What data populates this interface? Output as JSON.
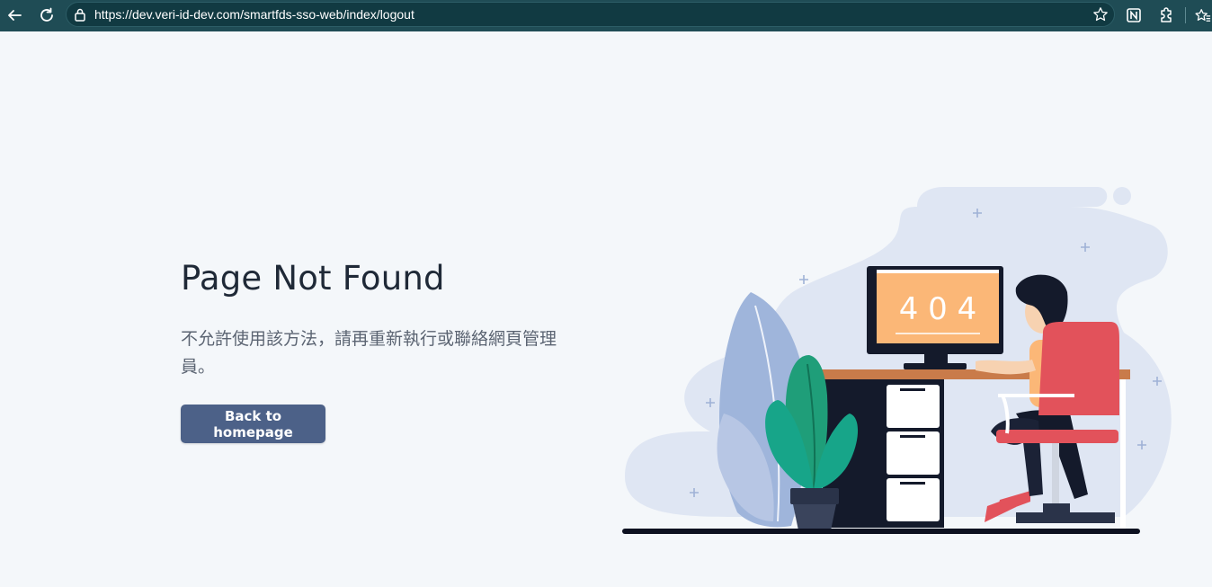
{
  "browser": {
    "url": "https://dev.veri-id-dev.com/smartfds-sso-web/index/logout",
    "icons": [
      "back-arrow-icon",
      "reload-icon",
      "lock-icon",
      "star-icon",
      "notion-extension-icon",
      "extensions-icon",
      "favorites-icon"
    ]
  },
  "page": {
    "title": "Page Not Found",
    "message": "不允許使用該方法，請再重新執行或聯絡網頁管理員。",
    "button_label": "Back to homepage"
  },
  "illustration": {
    "monitor_text": "4 0 4",
    "colors": {
      "blob": "#dfe6f3",
      "screen": "#fbb777",
      "chair": "#e2525b",
      "desk": "#c97b4a",
      "plant": "#1f9e79",
      "dark": "#141a2b"
    }
  }
}
